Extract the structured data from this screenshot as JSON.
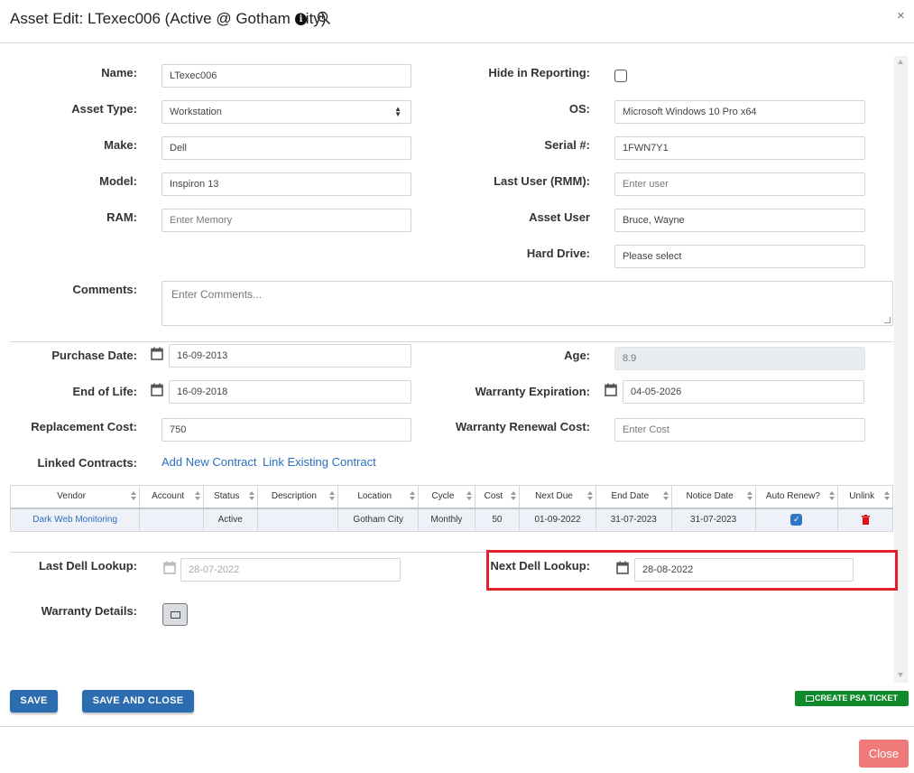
{
  "header": {
    "title": "Asset Edit: LTexec006 (Active @ Gotham City)",
    "close_symbol": "×"
  },
  "icons": {
    "info": "info-icon",
    "zoom": "zoom-in-icon",
    "calendar": "calendar-icon",
    "trash": "trash-icon",
    "ticket": "ticket-icon"
  },
  "form": {
    "name": {
      "label": "Name:",
      "value": "LTexec006"
    },
    "asset_type": {
      "label": "Asset Type:",
      "value": "Workstation",
      "caret": "⬍"
    },
    "make": {
      "label": "Make:",
      "value": "Dell"
    },
    "model": {
      "label": "Model:",
      "value": "Inspiron 13"
    },
    "ram": {
      "label": "RAM:",
      "placeholder": "Enter Memory"
    },
    "hide_in_reporting": {
      "label": "Hide in Reporting:",
      "checked": false
    },
    "os": {
      "label": "OS:",
      "value": "Microsoft Windows 10 Pro x64"
    },
    "serial": {
      "label": "Serial #:",
      "value": "1FWN7Y1"
    },
    "last_user": {
      "label": "Last User (RMM):",
      "placeholder": "Enter user"
    },
    "asset_user": {
      "label": "Asset User",
      "value": "Bruce, Wayne"
    },
    "hard_drive": {
      "label": "Hard Drive:",
      "placeholder": "Please select"
    },
    "comments": {
      "label": "Comments:",
      "placeholder": "Enter Comments..."
    },
    "purchase_date": {
      "label": "Purchase Date:",
      "value": "16-09-2013"
    },
    "end_of_life": {
      "label": "End of Life:",
      "value": "16-09-2018"
    },
    "replacement_cost": {
      "label": "Replacement Cost:",
      "value": "750"
    },
    "age": {
      "label": "Age:",
      "value": "8.9"
    },
    "warranty_expiration": {
      "label": "Warranty Expiration:",
      "value": "04-05-2026"
    },
    "warranty_renewal_cost": {
      "label": "Warranty Renewal Cost:",
      "placeholder": "Enter Cost"
    },
    "linked_contracts": {
      "label": "Linked Contracts:",
      "add_new": "Add New Contract",
      "link_existing": "Link Existing Contract"
    },
    "last_dell_lookup": {
      "label": "Last Dell Lookup:",
      "value": "28-07-2022"
    },
    "next_dell_lookup": {
      "label": "Next Dell Lookup:",
      "value": "28-08-2022"
    },
    "warranty_details": {
      "label": "Warranty Details:"
    }
  },
  "contracts_table": {
    "columns": [
      "Vendor",
      "Account",
      "Status",
      "Description",
      "Location",
      "Cycle",
      "Cost",
      "Next Due",
      "End Date",
      "Notice Date",
      "Auto Renew?",
      "Unlink"
    ],
    "rows": [
      {
        "vendor": "Dark Web Monitoring",
        "account": "",
        "status": "Active",
        "description": "",
        "location": "Gotham City",
        "cycle": "Monthly",
        "cost": "50",
        "next_due": "01-09-2022",
        "end_date": "31-07-2023",
        "notice_date": "31-07-2023",
        "auto_renew": true
      }
    ]
  },
  "footer": {
    "save": "SAVE",
    "save_and_close": "SAVE AND CLOSE",
    "create_psa_ticket": "CREATE PSA TICKET",
    "close": "Close"
  },
  "colors": {
    "primary_button": "#2c6cb0",
    "ticket_button": "#0f8a2a",
    "close_button": "#f07a7a",
    "highlight_box": "#e0202a",
    "link": "#2a6ebb"
  }
}
